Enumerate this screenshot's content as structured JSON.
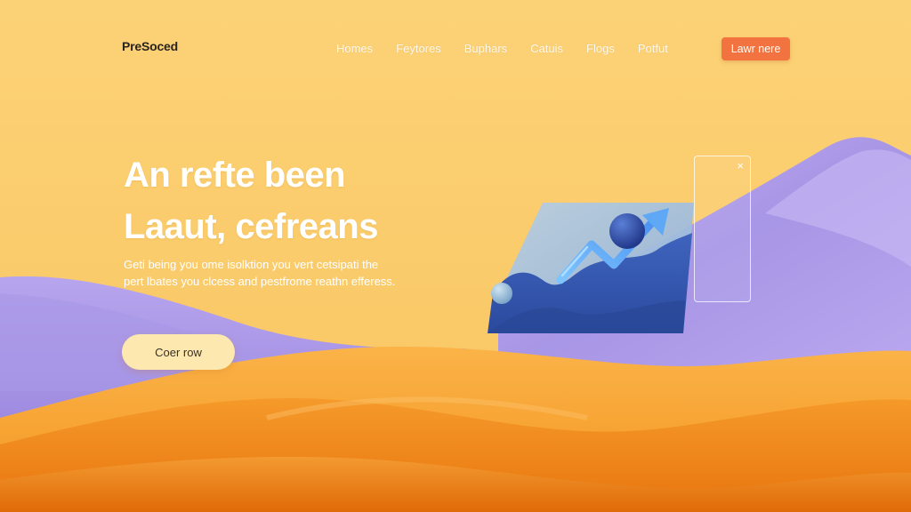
{
  "header": {
    "brand": "PreSoced",
    "nav": [
      "Homes",
      "Feytores",
      "Buphars",
      "Catuis",
      "Flogs",
      "Potfut"
    ],
    "cta": "Lawr nere"
  },
  "hero": {
    "title_line1": "An refte been",
    "title_line2": "Laaut, cefreans",
    "sub_line1": "Geti being you ome isolktion you vert cetsipati the",
    "sub_line2": "pert lbates you clcess and pestfrome reathn efferess.",
    "cta": "Coer row"
  },
  "panel": {
    "close_icon": "×"
  },
  "colors": {
    "background": "#fbd06c",
    "accent": "#f2733f",
    "cta_hero": "#fde9b0",
    "lavender": "#b6a4ec",
    "orange": "#f08a1c",
    "chart_blue": "#3a5fb8"
  }
}
